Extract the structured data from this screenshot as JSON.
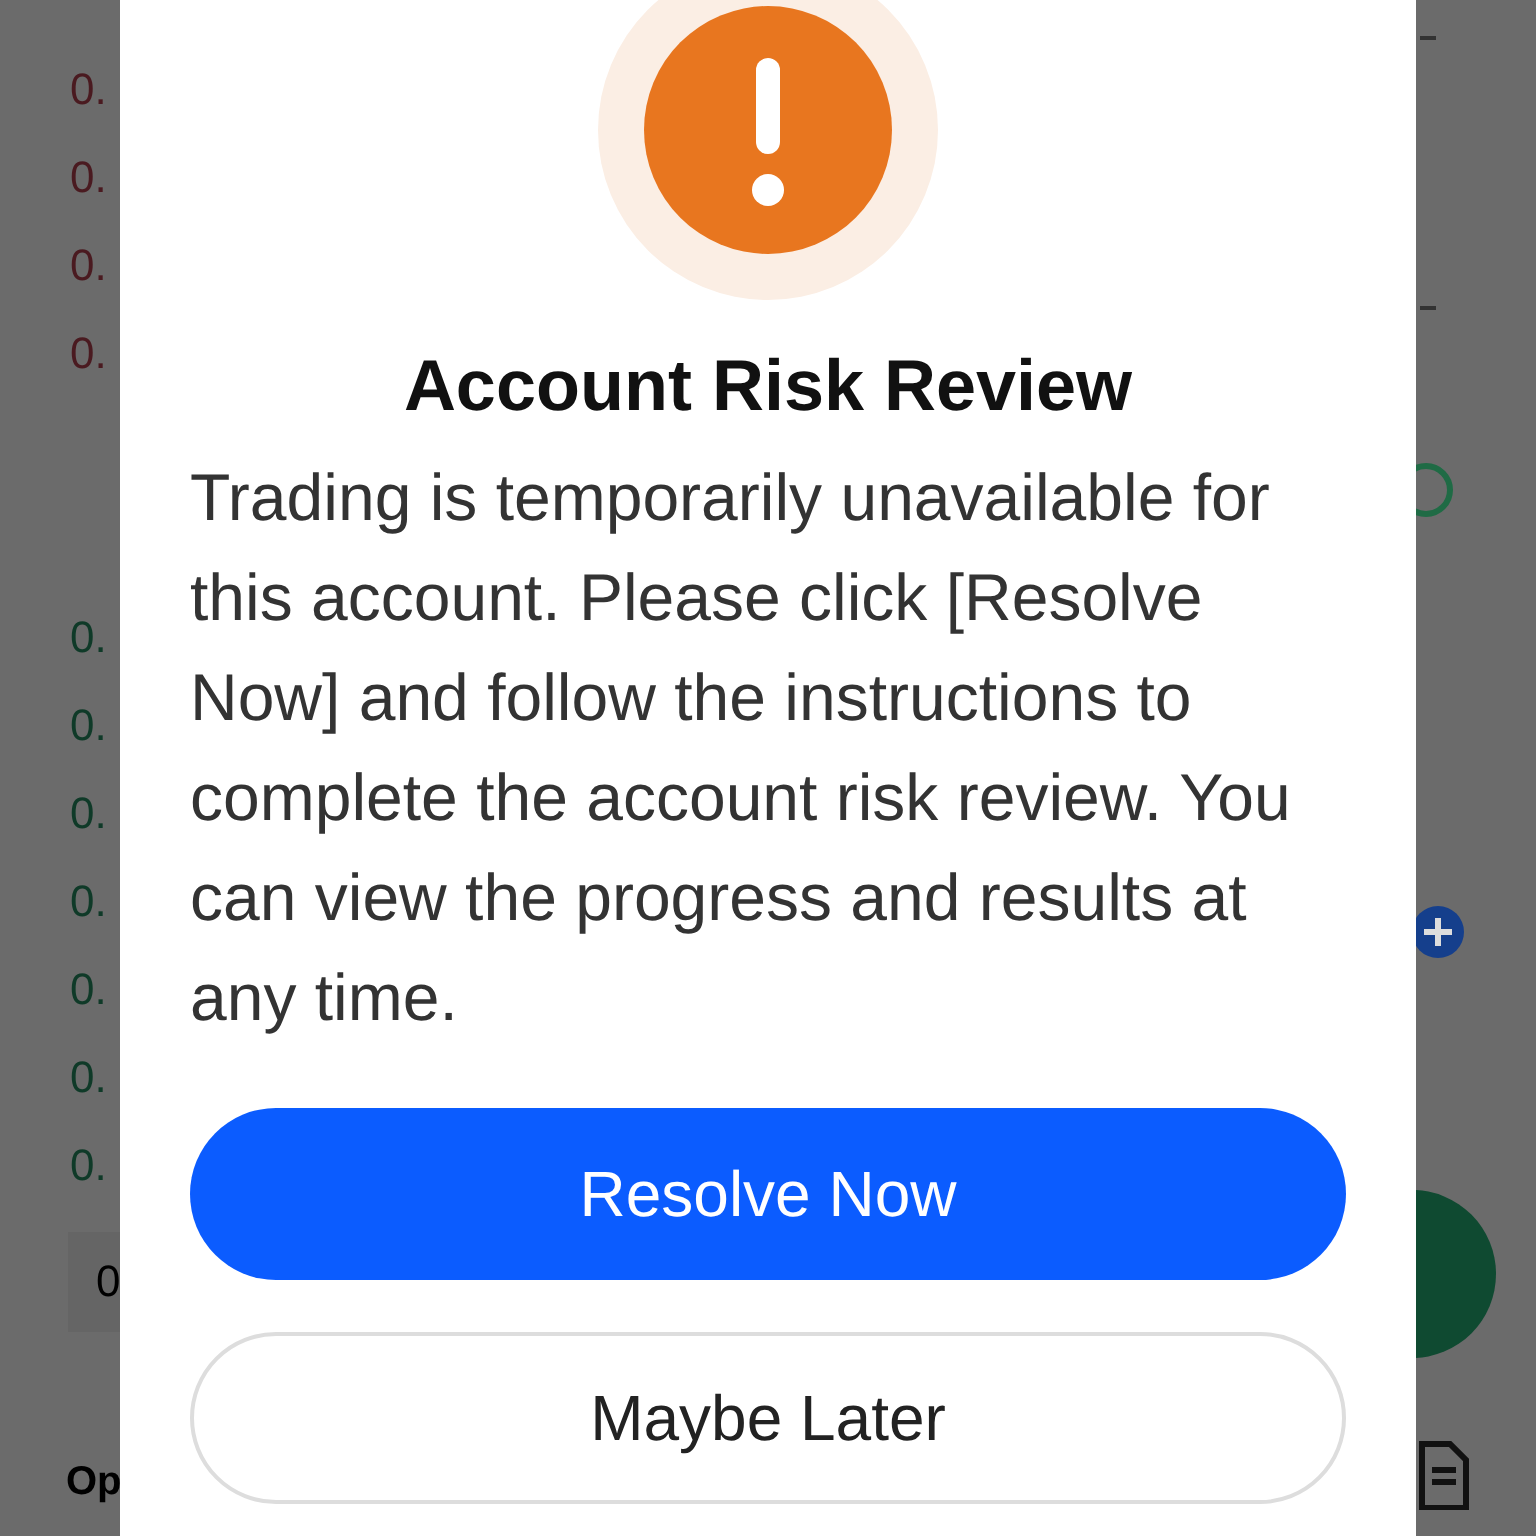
{
  "background": {
    "prices": [
      {
        "text": "0.",
        "color": "#4a1a20"
      },
      {
        "text": "0.",
        "color": "#4a1a20"
      },
      {
        "text": "0.",
        "color": "#4a1a20"
      },
      {
        "text": "0.",
        "color": "#4a1a20"
      },
      {
        "text": "0.",
        "color": "#0f3a28"
      },
      {
        "text": "0.",
        "color": "#0f3a28"
      },
      {
        "text": "0.",
        "color": "#0f3a28"
      },
      {
        "text": "0.",
        "color": "#0f3a28"
      },
      {
        "text": "0.",
        "color": "#0f3a28"
      },
      {
        "text": "0.",
        "color": "#0f3a28"
      },
      {
        "text": "0.",
        "color": "#0f3a28"
      }
    ],
    "quantity": "0",
    "section_heading": "Op"
  },
  "dialog": {
    "title": "Account Risk Review",
    "message": "Trading is temporarily unavailable for this account. Please click [Resolve Now] and follow the instructions to complete the account risk review. You can view the progress and results at any time.",
    "buttons": [
      {
        "label": "Resolve Now",
        "kind": "primary"
      },
      {
        "label": "Maybe Later",
        "kind": "secondary"
      }
    ]
  }
}
